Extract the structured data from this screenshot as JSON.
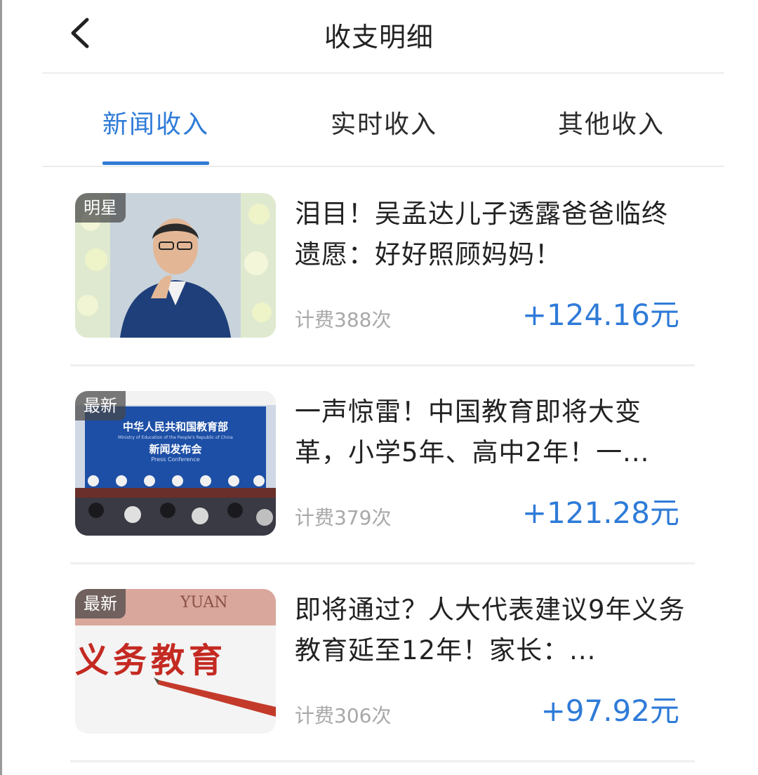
{
  "header": {
    "title": "收支明细",
    "back_icon": "chevron-left-icon"
  },
  "tabs": [
    {
      "label": "新闻收入",
      "active": true
    },
    {
      "label": "实时收入",
      "active": false
    },
    {
      "label": "其他收入",
      "active": false
    }
  ],
  "colors": {
    "accent": "#2f7bd8",
    "muted": "#a8a8a8",
    "text": "#222222"
  },
  "news": [
    {
      "badge": "明星",
      "title": "泪目！吴孟达儿子透露爸爸临终遗愿：好好照顾妈妈！",
      "views": "计费388次",
      "amount": "+124.16元"
    },
    {
      "badge": "最新",
      "title": "一声惊雷！中国教育即将大变革，小学5年、高中2年！一...",
      "views": "计费379次",
      "amount": "+121.28元",
      "image_text": {
        "line1": "中华人民共和国教育部",
        "line2": "Ministry of Education of the People's Republic of China",
        "line3": "新闻发布会",
        "line4": "Press Conference"
      }
    },
    {
      "badge": "最新",
      "title": "即将通过？人大代表建议9年义务教育延至12年！家长：...",
      "views": "计费306次",
      "amount": "+97.92元",
      "image_text": {
        "big": "义务教育",
        "banknote": "YUAN"
      }
    }
  ]
}
